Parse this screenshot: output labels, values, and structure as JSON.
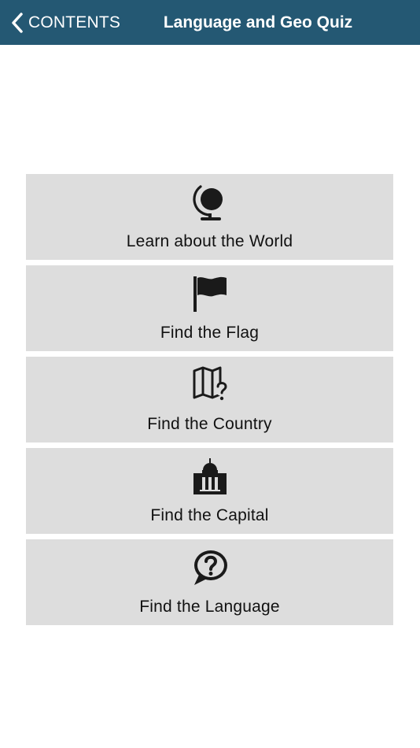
{
  "header": {
    "back_label": "CONTENTS",
    "title": "Language and Geo Quiz"
  },
  "menu": {
    "items": [
      {
        "label": "Learn about the World",
        "icon": "globe-icon"
      },
      {
        "label": "Find the Flag",
        "icon": "flag-icon"
      },
      {
        "label": "Find the Country",
        "icon": "map-question-icon"
      },
      {
        "label": "Find the Capital",
        "icon": "capitol-building-icon"
      },
      {
        "label": "Find the Language",
        "icon": "speech-bubble-question-icon"
      }
    ]
  },
  "colors": {
    "header_bg": "#245873",
    "tile_bg": "#dddddd",
    "icon": "#1a1a1a"
  }
}
